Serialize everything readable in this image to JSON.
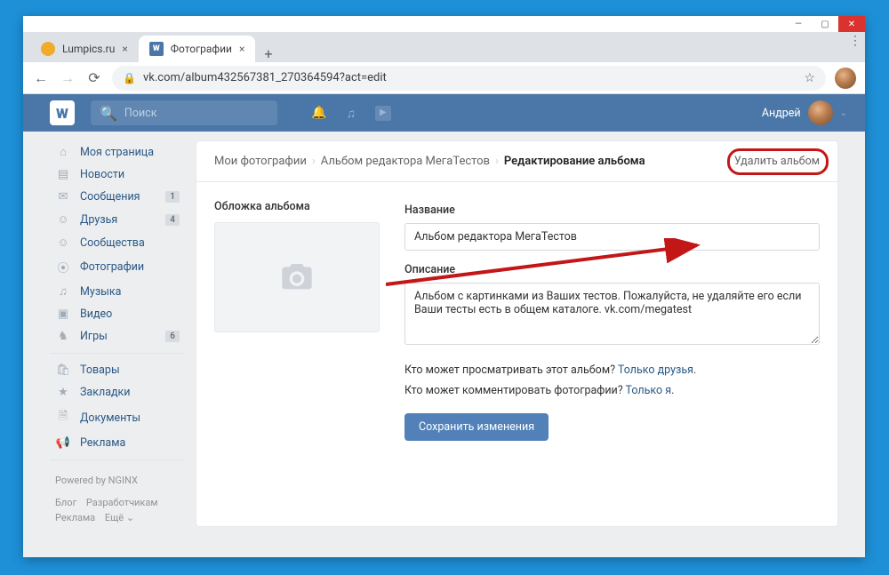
{
  "window": {
    "title": "Фотографии"
  },
  "tabs": [
    {
      "label": "Lumpics.ru",
      "favicon_bg": "#f0ac28",
      "active": false
    },
    {
      "label": "Фотографии",
      "favicon_bg": "#4a76a8",
      "active": true
    }
  ],
  "addressbar": {
    "url": "vk.com/album432567381_270364594?act=edit"
  },
  "vk_header": {
    "search_placeholder": "Поиск",
    "user_name": "Андрей"
  },
  "sidebar": {
    "items": [
      {
        "icon": "⌂",
        "label": "Моя страница",
        "badge": ""
      },
      {
        "icon": "▤",
        "label": "Новости",
        "badge": ""
      },
      {
        "icon": "✉",
        "label": "Сообщения",
        "badge": "1"
      },
      {
        "icon": "☺",
        "label": "Друзья",
        "badge": "4"
      },
      {
        "icon": "☺",
        "label": "Сообщества",
        "badge": ""
      },
      {
        "icon": "⦿",
        "label": "Фотографии",
        "badge": ""
      },
      {
        "icon": "♫",
        "label": "Музыка",
        "badge": ""
      },
      {
        "icon": "▣",
        "label": "Видео",
        "badge": ""
      },
      {
        "icon": "♞",
        "label": "Игры",
        "badge": "6"
      }
    ],
    "items2": [
      {
        "icon": "🛍",
        "label": "Товары"
      },
      {
        "icon": "★",
        "label": "Закладки"
      },
      {
        "icon": "🗎",
        "label": "Документы"
      },
      {
        "icon": "📢",
        "label": "Реклама"
      }
    ],
    "powered": "Powered by NGINX",
    "links_row1": [
      "Блог",
      "Разработчикам"
    ],
    "links_row2": [
      "Реклама",
      "Ещё ⌄"
    ]
  },
  "breadcrumbs": {
    "a": "Мои фотографии",
    "b": "Альбом редактора МегаТестов",
    "c": "Редактирование альбома",
    "delete": "Удалить альбом"
  },
  "editor": {
    "cover_label": "Обложка альбома",
    "title_label": "Название",
    "title_value": "Альбом редактора МегаТестов",
    "desc_label": "Описание",
    "desc_value": "Альбом с картинками из Ваших тестов. Пожалуйста, не удаляйте его если Ваши тесты есть в общем каталоге. vk.com/megatest",
    "privacy_view_q": "Кто может просматривать этот альбом?",
    "privacy_view_a": "Только друзья",
    "privacy_comm_q": "Кто может комментировать фотографии?",
    "privacy_comm_a": "Только я",
    "save": "Сохранить изменения"
  }
}
